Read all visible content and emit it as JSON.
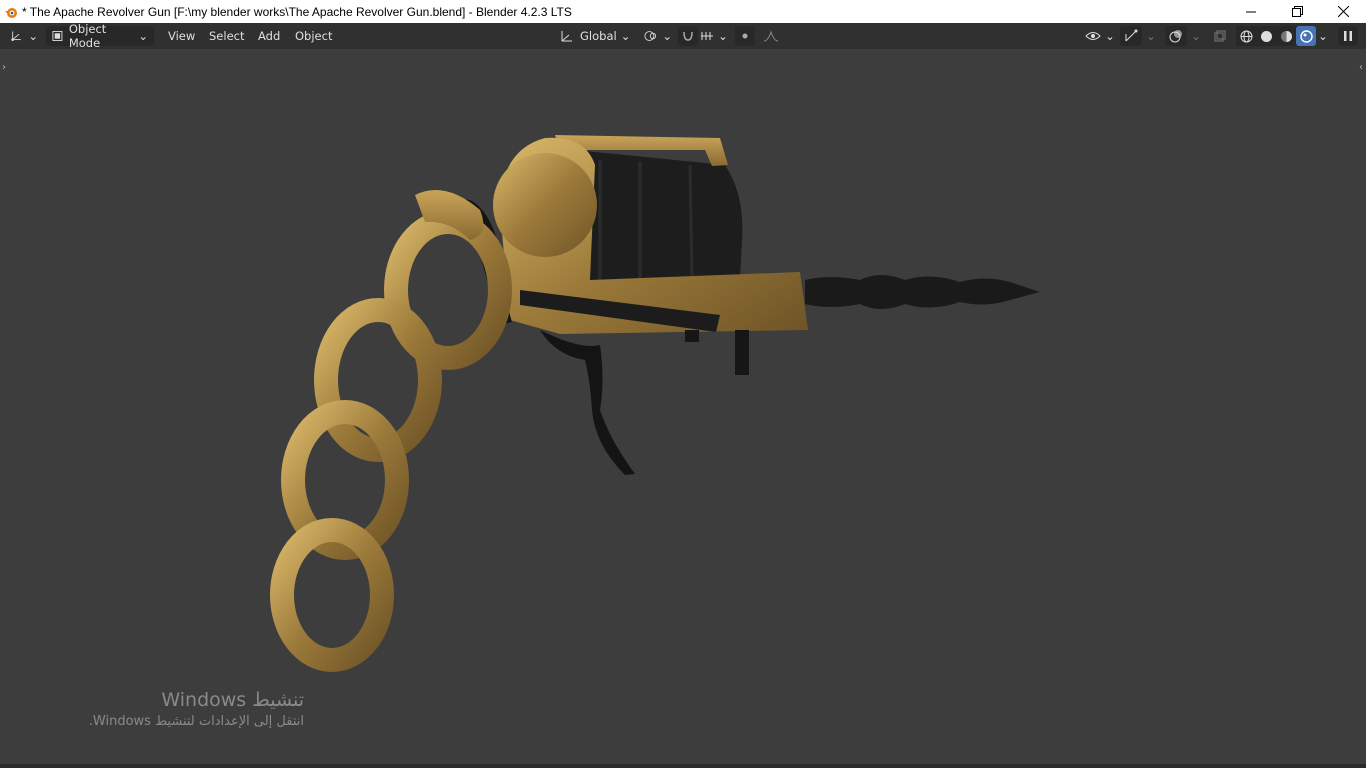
{
  "window": {
    "title": "* The Apache Revolver Gun [F:\\my blender works\\The Apache Revolver Gun.blend] - Blender 4.2.3 LTS",
    "minimize_icon": "minimize-icon",
    "restore_icon": "restore-icon",
    "close_icon": "close-icon"
  },
  "header": {
    "editor_type_icon": "3d-viewport-icon",
    "mode_label": "Object Mode",
    "menus": [
      "View",
      "Select",
      "Add",
      "Object"
    ],
    "transform_orientation": "Global",
    "pivot_icon": "pivot-point-icon",
    "snap_icon": "snap-icon",
    "proportional_icon": "proportional-editing-icon",
    "right_icons": [
      "visibility-icon",
      "gizmo-icon",
      "overlay-icon",
      "xray-icon",
      "wireframe-shading-icon",
      "solid-shading-icon",
      "material-preview-icon",
      "rendered-shading-icon"
    ]
  },
  "watermark": {
    "line1": "تنشيط Windows",
    "line2": "انتقل إلى الإعدادات لتنشيط Windows."
  },
  "colors": {
    "titlebar": "#ffffff",
    "header": "#303030",
    "viewport": "#3d3d3d",
    "accent": "#4772b3",
    "gold": "#b8944a",
    "dark_metal": "#1c1c1c"
  }
}
